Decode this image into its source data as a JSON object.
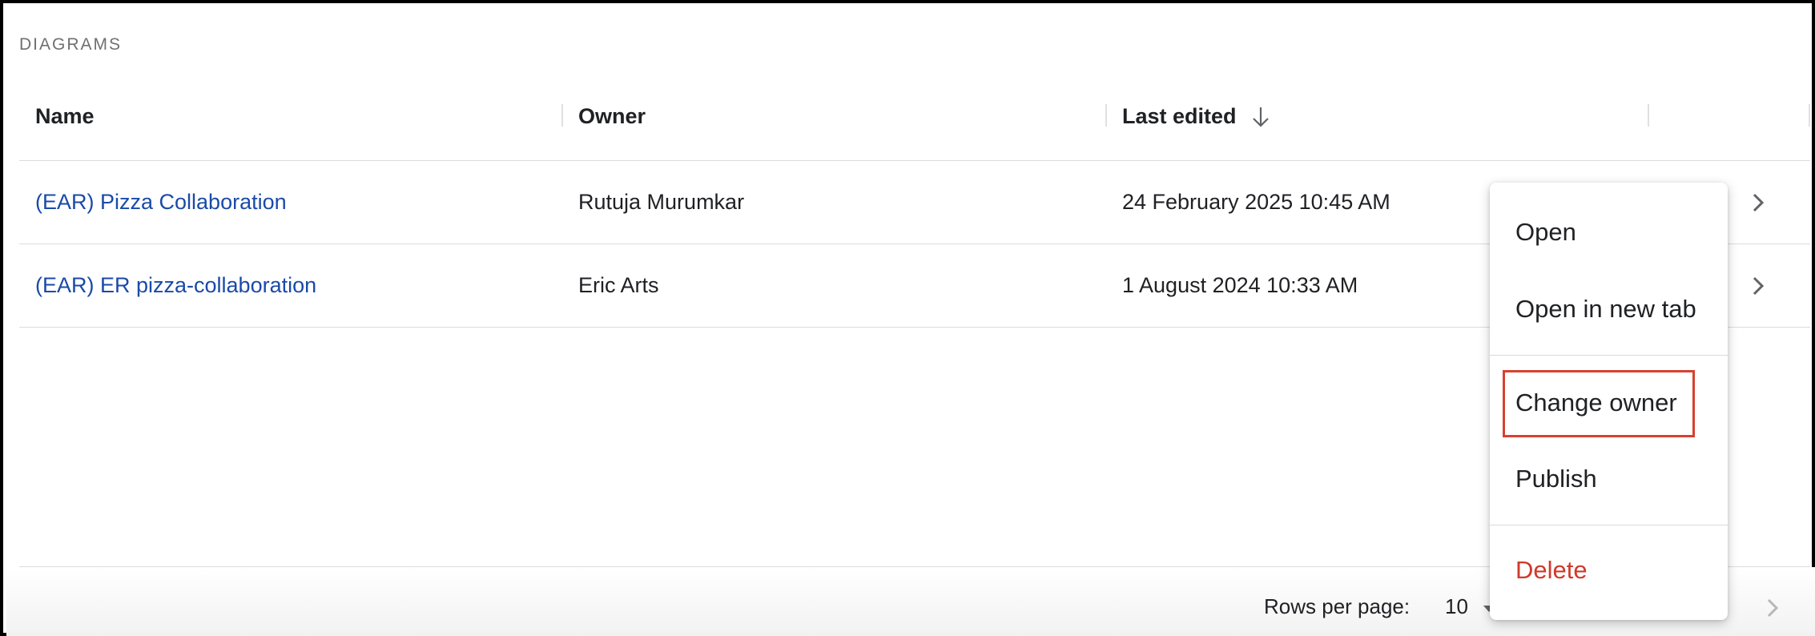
{
  "section": {
    "title": "DIAGRAMS"
  },
  "table": {
    "columns": [
      {
        "label": "Name"
      },
      {
        "label": "Owner"
      },
      {
        "label": "Last edited"
      }
    ],
    "rows": [
      {
        "name": "(EAR) Pizza Collaboration",
        "owner": "Rutuja Murumkar",
        "last_edited": "24 February 2025 10:45 AM"
      },
      {
        "name": "(EAR) ER pizza-collaboration",
        "owner": "Eric Arts",
        "last_edited": "1 August 2024 10:33 AM"
      }
    ]
  },
  "pagination": {
    "rows_per_page_label": "Rows per page:",
    "rows_per_page_value": "10"
  },
  "context_menu": {
    "items": [
      {
        "label": "Open"
      },
      {
        "label": "Open in new tab"
      },
      {
        "label": "Change owner"
      },
      {
        "label": "Publish"
      },
      {
        "label": "Delete"
      }
    ]
  },
  "colors": {
    "link": "#1a4aa8",
    "danger": "#d0392b",
    "highlight": "#d8412f"
  },
  "icons": [
    "arrow-down-icon",
    "chevron-right-icon"
  ]
}
